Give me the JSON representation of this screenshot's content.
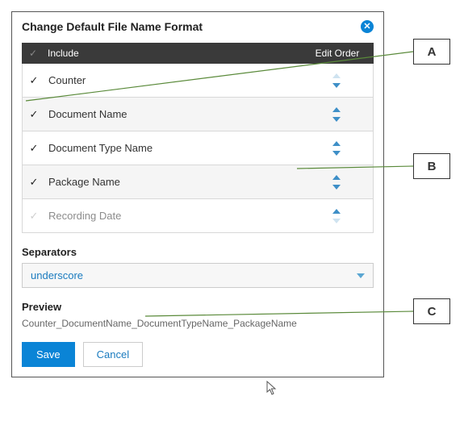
{
  "dialog": {
    "title": "Change Default File Name Format",
    "close_symbol": "✕"
  },
  "columns": {
    "include": "Include",
    "edit_order": "Edit Order"
  },
  "rows": [
    {
      "label": "Counter",
      "checked": true,
      "up_enabled": false,
      "down_enabled": true,
      "alt": false
    },
    {
      "label": "Document Name",
      "checked": true,
      "up_enabled": true,
      "down_enabled": true,
      "alt": true
    },
    {
      "label": "Document Type Name",
      "checked": true,
      "up_enabled": true,
      "down_enabled": true,
      "alt": false
    },
    {
      "label": "Package Name",
      "checked": true,
      "up_enabled": true,
      "down_enabled": true,
      "alt": true
    },
    {
      "label": "Recording Date",
      "checked": false,
      "up_enabled": true,
      "down_enabled": false,
      "alt": false
    }
  ],
  "separators": {
    "label": "Separators",
    "selected": "underscore"
  },
  "preview": {
    "label": "Preview",
    "value": "Counter_DocumentName_DocumentTypeName_PackageName"
  },
  "buttons": {
    "save": "Save",
    "cancel": "Cancel"
  },
  "callouts": {
    "a": "A",
    "b": "B",
    "c": "C"
  }
}
